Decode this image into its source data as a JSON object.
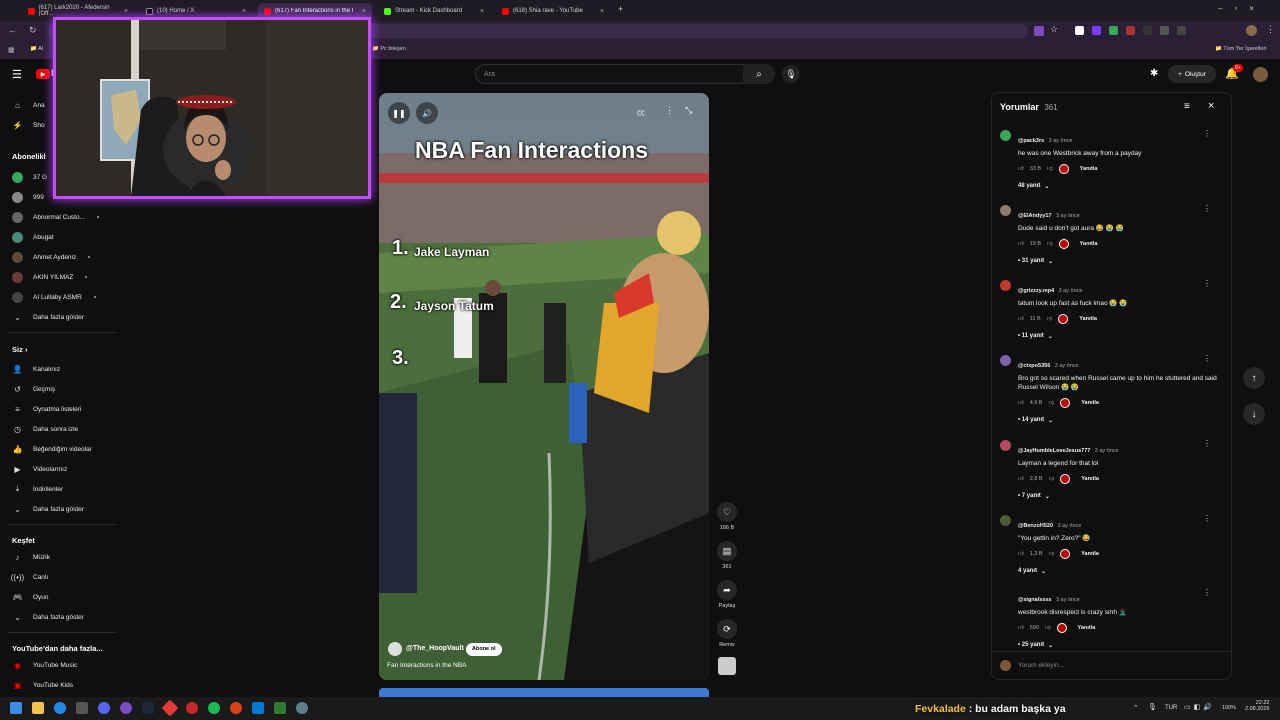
{
  "browser": {
    "tabs": [
      {
        "label": "(617) Lark2020 - Afedersin (Off...",
        "active": false
      },
      {
        "label": "(10) Home / X",
        "active": false
      },
      {
        "label": "(617) Fan Interactions in the NBA",
        "active": true
      },
      {
        "label": "Stream - Kick Dashboard",
        "active": false
      },
      {
        "label": "(618) Shia rave - YouTube",
        "active": false
      }
    ],
    "bookmarks_left": "Al",
    "bookmarks_item": "Pc bileşen",
    "bookmarks_right": "Tüm Yer İşaretleri"
  },
  "header": {
    "logo_letter": "P",
    "search_placeholder": "Ara",
    "create_label": "Oluştur",
    "notifications_badge": "9+"
  },
  "sidebar": {
    "top_items": [
      {
        "label": "Ana"
      },
      {
        "label": "Sho"
      }
    ],
    "subscriptions_title": "Abonelikl",
    "subscriptions": [
      {
        "label": "37 G"
      },
      {
        "label": "999"
      },
      {
        "label": "Abnormal Custo..."
      },
      {
        "label": "Abugat"
      },
      {
        "label": "Ahmet Aydeniz"
      },
      {
        "label": "AKIN YILMAZ"
      },
      {
        "label": "AI Lullaby ASMR"
      }
    ],
    "show_more": "Daha fazla göster",
    "you_title": "Siz",
    "you_items": [
      {
        "label": "Kanalınız",
        "icon": "channel-icon"
      },
      {
        "label": "Geçmiş",
        "icon": "history-icon"
      },
      {
        "label": "Oynatma listeleri",
        "icon": "playlist-icon"
      },
      {
        "label": "Daha sonra izle",
        "icon": "clock-icon"
      },
      {
        "label": "Beğendiğim videolar",
        "icon": "like-icon"
      },
      {
        "label": "Videolarınız",
        "icon": "video-icon"
      },
      {
        "label": "İndirilenler",
        "icon": "download-icon"
      },
      {
        "label": "Daha fazla göster",
        "icon": "chevron-down-icon"
      }
    ],
    "explore_title": "Keşfet",
    "explore_items": [
      {
        "label": "Müzik",
        "icon": "music-icon"
      },
      {
        "label": "Canlı",
        "icon": "live-icon"
      },
      {
        "label": "Oyun",
        "icon": "gaming-icon"
      },
      {
        "label": "Daha fazla göster",
        "icon": "chevron-down-icon"
      }
    ],
    "more_title": "YouTube'dan daha fazla...",
    "more_items": [
      {
        "label": "YouTube Music"
      },
      {
        "label": "YouTube Kids"
      }
    ]
  },
  "video": {
    "title_overlay": "NBA Fan Interactions",
    "list": [
      "1.",
      "Jake Layman",
      "2.",
      "Jayson Tatum",
      "3."
    ],
    "channel": "@The_HoopVault",
    "subscribe": "Abone ol",
    "caption": "Fan Interactions in the NBA"
  },
  "actions": {
    "likes": "166 B",
    "comments": "361",
    "share": "Paylaş",
    "remix": "Remix"
  },
  "comments": {
    "title": "Yorumlar",
    "count": "361",
    "reply_label": "Yanıtla",
    "add_placeholder": "Yorum ekleyin...",
    "items": [
      {
        "author": "@pack3rs",
        "time": "3 ay önce",
        "text": "he was one Westbrick away from a payday",
        "likes": "33 B",
        "replies": "48 yanıt",
        "avatar_color": "#3aa657"
      },
      {
        "author": "@ElAndyy17",
        "time": "3 ay önce",
        "text": "Dude said u don't got aura 😂 😭 😭",
        "likes": "19 B",
        "replies": "• 31 yanıt",
        "avatar_color": "#8a7a6a"
      },
      {
        "author": "@grizzzy.mp4",
        "time": "3 ay önce",
        "text": "tatum look up fast as fuck lmao 😭 😭",
        "likes": "11 B",
        "replies": "• 11 yanıt",
        "avatar_color": "#c0392b"
      },
      {
        "author": "@ctxpo5356",
        "time": "3 ay önce",
        "text": "Bro got so scared when Russel came up to him he stuttered and said Russel Wilson 😭 😭",
        "likes": "4,9 B",
        "replies": "• 14 yanıt",
        "avatar_color": "#7d5fa8"
      },
      {
        "author": "@JayHumbleLoveJesus777",
        "time": "3 ay önce",
        "text": "Layman a legend for that lol",
        "likes": "2,8 B",
        "replies": "• 7 yanıt",
        "avatar_color": "#b5485f"
      },
      {
        "author": "@BenzoH520",
        "time": "3 ay önce",
        "text": "\"You gettin in? Zero?\" 😂",
        "likes": "1,3 B",
        "replies": "4 yanıt",
        "avatar_color": "#4a5a3a"
      },
      {
        "author": "@signalssss",
        "time": "3 ay önce",
        "text": "westbrook disrespect is crazy smh 🤦🏿‍♂️",
        "likes": "590",
        "replies": "• 25 yanıt",
        "avatar_color": "#111111"
      }
    ]
  },
  "taskbar": {
    "chat_user": "Fevkalade",
    "chat_message": " : bu adam başka ya",
    "lang": "TUR",
    "battery": "100%",
    "time": "22:22",
    "date": "2.08.2026"
  },
  "colors": {
    "accent_purple": "#c64dff",
    "youtube_red": "#ff0000",
    "chat_user": "#f5c242"
  }
}
